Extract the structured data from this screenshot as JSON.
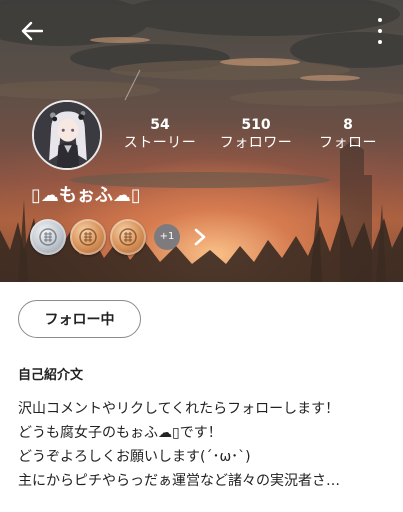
{
  "profile": {
    "username": "▯☁もぉふ☁▯",
    "stats": {
      "stories": {
        "count": "54",
        "label": "ストーリー"
      },
      "followers": {
        "count": "510",
        "label": "フォロワー"
      },
      "following": {
        "count": "8",
        "label": "フォロー"
      }
    },
    "badges": {
      "items": [
        "silver",
        "bronze",
        "bronze"
      ],
      "more_label": "+1"
    }
  },
  "actions": {
    "follow_button_label": "フォロー中"
  },
  "bio": {
    "title": "自己紹介文",
    "lines": [
      "沢山コメントやリクしてくれたらフォローします！",
      "どうも腐女子のもぉふ☁▯です！",
      "どうぞよろしくお願いします(´･ω･`)",
      "主にからピチやらっだぁ運営など諸々の実況者さ…"
    ]
  },
  "icons": {
    "back": "arrow-left-icon",
    "more": "more-vertical-icon",
    "next": "chevron-right-icon"
  },
  "colors": {
    "text_on_cover": "#ffffff",
    "button_border": "#8b8b8b"
  }
}
